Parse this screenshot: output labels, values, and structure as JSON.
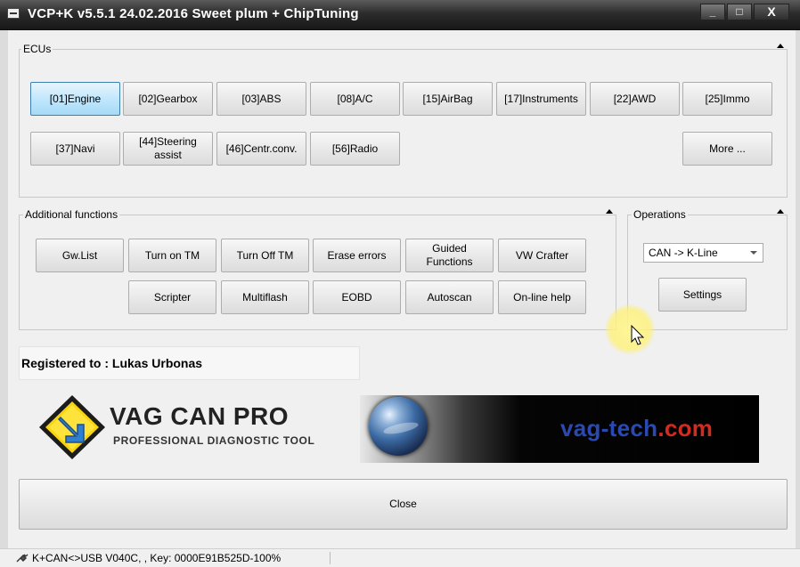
{
  "window": {
    "title": "VCP+K v5.5.1 24.02.2016 Sweet plum + ChipTuning",
    "controls": {
      "minimize": "_",
      "maximize": "□",
      "close": "X"
    }
  },
  "ecus": {
    "label": "ECUs",
    "buttons": [
      "[01]Engine",
      "[02]Gearbox",
      "[03]ABS",
      "[08]A/C",
      "[15]AirBag",
      "[17]Instruments",
      "[22]AWD",
      "[25]Immo",
      "[37]Navi",
      "[44]Steering assist",
      "[46]Centr.conv.",
      "[56]Radio"
    ],
    "more": "More ..."
  },
  "additional": {
    "label": "Additional functions",
    "buttons": [
      "Gw.List",
      "Turn on TM",
      "Turn Off TM",
      "Erase errors",
      "Guided Functions",
      "VW Crafter",
      "Scripter",
      "Multiflash",
      "EOBD",
      "Autoscan",
      "On-line help"
    ]
  },
  "operations": {
    "label": "Operations",
    "interface_selected": "CAN -> K-Line",
    "settings": "Settings"
  },
  "registered": "Registered to : Lukas Urbonas",
  "logo": {
    "title": "VAG CAN PRO",
    "subtitle": "PROFESSIONAL DIAGNOSTIC TOOL"
  },
  "banner": {
    "site_blue": "vag-tech",
    "site_red": ".com"
  },
  "close_label": "Close",
  "status": "K+CAN<>USB V040C, , Key: 0000E91B525D-100%",
  "colors": {
    "titlebar": "#2c2c2c",
    "active_button": "#bee6fd",
    "site_blue": "#2a49b3",
    "site_red": "#d42a1f"
  }
}
